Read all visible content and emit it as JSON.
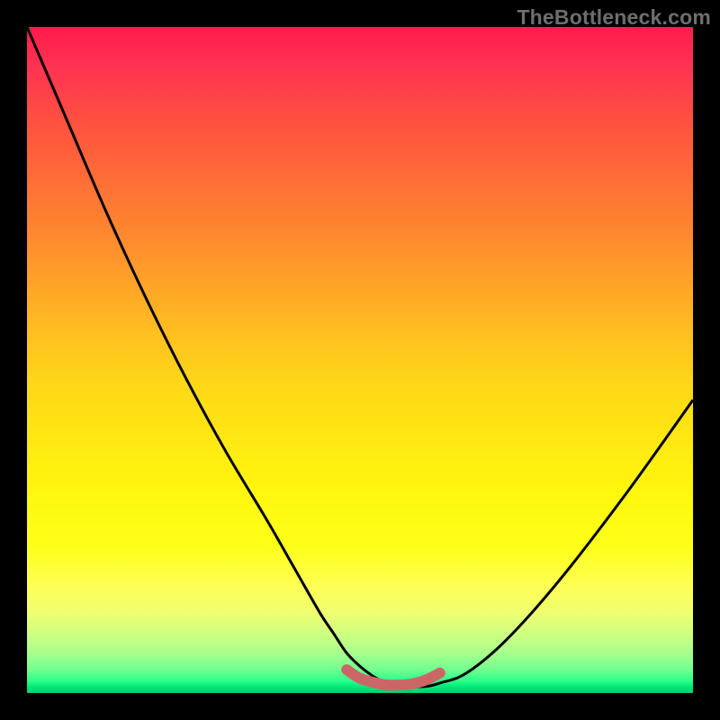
{
  "watermark": "TheBottleneck.com",
  "chart_data": {
    "type": "line",
    "title": "",
    "xlabel": "",
    "ylabel": "",
    "xlim": [
      0,
      100
    ],
    "ylim": [
      0,
      100
    ],
    "series": [
      {
        "name": "bottleneck-curve",
        "x": [
          0,
          6,
          12,
          18,
          24,
          30,
          36,
          40,
          44,
          46,
          48,
          50,
          52,
          54,
          57,
          60,
          62,
          66,
          72,
          80,
          90,
          100
        ],
        "y": [
          100,
          86,
          72,
          59,
          47,
          36,
          26,
          19,
          12,
          9,
          6,
          4,
          2.5,
          1.5,
          1,
          1,
          1.5,
          3,
          8,
          17,
          30,
          44
        ]
      },
      {
        "name": "highlight-band",
        "x": [
          48,
          50,
          52,
          54,
          56,
          58,
          60,
          62
        ],
        "y": [
          3.5,
          2.2,
          1.6,
          1.2,
          1.2,
          1.4,
          2.0,
          3.0
        ]
      }
    ],
    "colors": {
      "curve": "#000000",
      "highlight": "#cc6666"
    }
  }
}
